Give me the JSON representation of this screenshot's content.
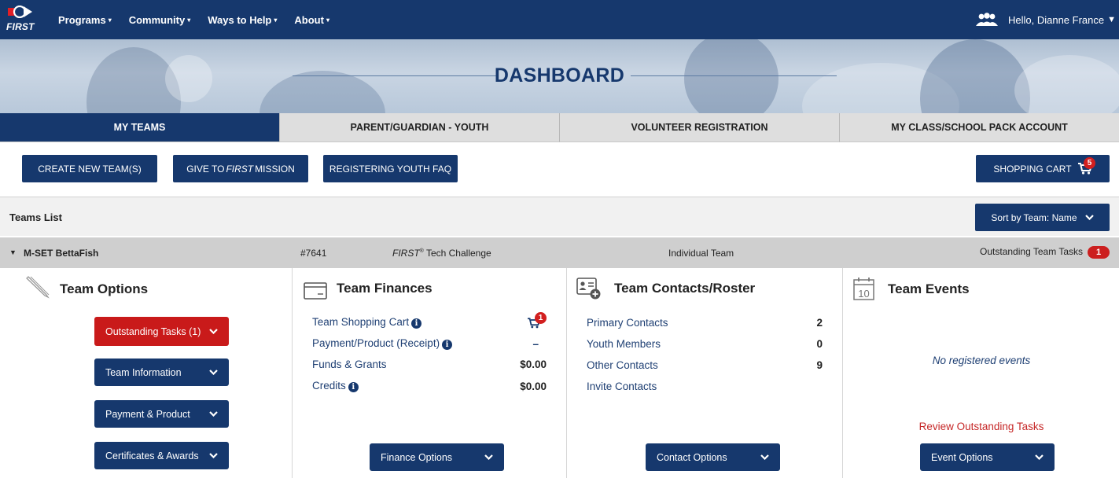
{
  "nav": {
    "logo_text": "FIRST",
    "items": [
      {
        "label": "Programs",
        "caret": "▾"
      },
      {
        "label": "Community",
        "caret": "▾"
      },
      {
        "label": "Ways to Help",
        "caret": "▾"
      },
      {
        "label": "About",
        "caret": "▾"
      }
    ],
    "greeting": "Hello, Dianne France",
    "user_caret": "▼"
  },
  "banner": {
    "title": "DASHBOARD"
  },
  "tabs": [
    {
      "label": "MY TEAMS",
      "active": true
    },
    {
      "label": "PARENT/GUARDIAN - YOUTH",
      "active": false
    },
    {
      "label": "VOLUNTEER REGISTRATION",
      "active": false
    },
    {
      "label": "MY CLASS/SCHOOL PACK ACCOUNT",
      "active": false
    }
  ],
  "actions": {
    "create_team": "CREATE NEW TEAM(S)",
    "give_prefix": "GIVE TO",
    "give_em": "FIRST",
    "give_suffix": "MISSION",
    "faq": "REGISTERING YOUTH FAQ",
    "cart_label": "SHOPPING CART",
    "cart_count": "5"
  },
  "teams_list": {
    "label": "Teams List",
    "sort_label": "Sort by Team: Name"
  },
  "team": {
    "name": "M-SET BettaFish",
    "number": "#7641",
    "program_em": "FIRST",
    "program_sup": "®",
    "program_rest": " Tech Challenge",
    "type": "Individual Team",
    "outstanding_label": "Outstanding Team Tasks",
    "outstanding_count": "1"
  },
  "team_options": {
    "title": "Team Options",
    "buttons": [
      {
        "label": "Outstanding Tasks (1)",
        "style": "red"
      },
      {
        "label": "Team Information",
        "style": "blue"
      },
      {
        "label": "Payment & Product",
        "style": "blue"
      },
      {
        "label": "Certificates & Awards",
        "style": "blue"
      }
    ]
  },
  "finances": {
    "title": "Team Finances",
    "rows": [
      {
        "label": "Team Shopping Cart",
        "value": "",
        "badge": "1"
      },
      {
        "label": "Payment/Product (Receipt)",
        "value": "–"
      },
      {
        "label": "Funds & Grants",
        "value": "$0.00"
      },
      {
        "label": "Credits",
        "value": "$0.00"
      }
    ],
    "button": "Finance Options"
  },
  "contacts": {
    "title": "Team Contacts/Roster",
    "rows": [
      {
        "label": "Primary Contacts",
        "value": "2"
      },
      {
        "label": "Youth Members",
        "value": "0"
      },
      {
        "label": "Other Contacts",
        "value": "9"
      },
      {
        "label": "Invite Contacts",
        "value": ""
      }
    ],
    "button": "Contact Options"
  },
  "events": {
    "title": "Team Events",
    "calendar_day": "10",
    "empty": "No registered events",
    "review_link": "Review Outstanding Tasks",
    "button": "Event Options"
  },
  "colors": {
    "navy": "#16386d",
    "red": "#c91a1a",
    "tab_grey": "#dedede"
  }
}
